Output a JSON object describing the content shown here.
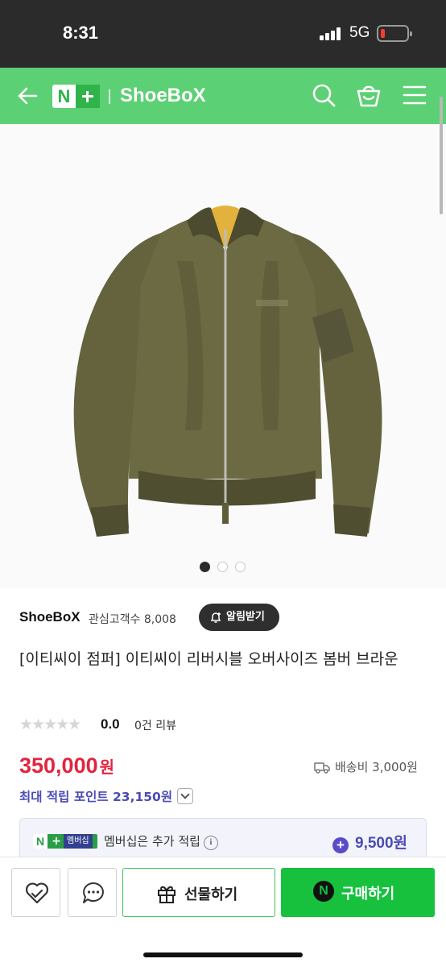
{
  "status_bar": {
    "time": "8:31",
    "network": "5G"
  },
  "header": {
    "store_name": "ShoeBoX"
  },
  "gallery": {
    "total_images": 3,
    "active_index": 0
  },
  "store": {
    "name": "ShoeBoX",
    "followers_label": "관심고객수 8,008",
    "alarm_label": "알림받기"
  },
  "product": {
    "title": "[이티씨이 점퍼] 이티씨이 리버시블 오버사이즈 봄버 브라운",
    "stars": "★★★★★",
    "rating_score": "0.0",
    "reviews_label": "0건 리뷰",
    "price": "350,000",
    "currency": "원",
    "shipping_label": "배송비 3,000원",
    "points_label": "최대 적립 포인트 23,150원"
  },
  "membership": {
    "badge_text": "멤버십",
    "text": "멤버십은 추가 적립",
    "points": "9,500원"
  },
  "bottom_bar": {
    "gift_label": "선물하기",
    "buy_label": "구매하기"
  },
  "colors": {
    "brand_green": "#5cd074",
    "price_red": "#e1253f",
    "points_purple": "#4b4bb5",
    "buy_green": "#17c13d"
  }
}
